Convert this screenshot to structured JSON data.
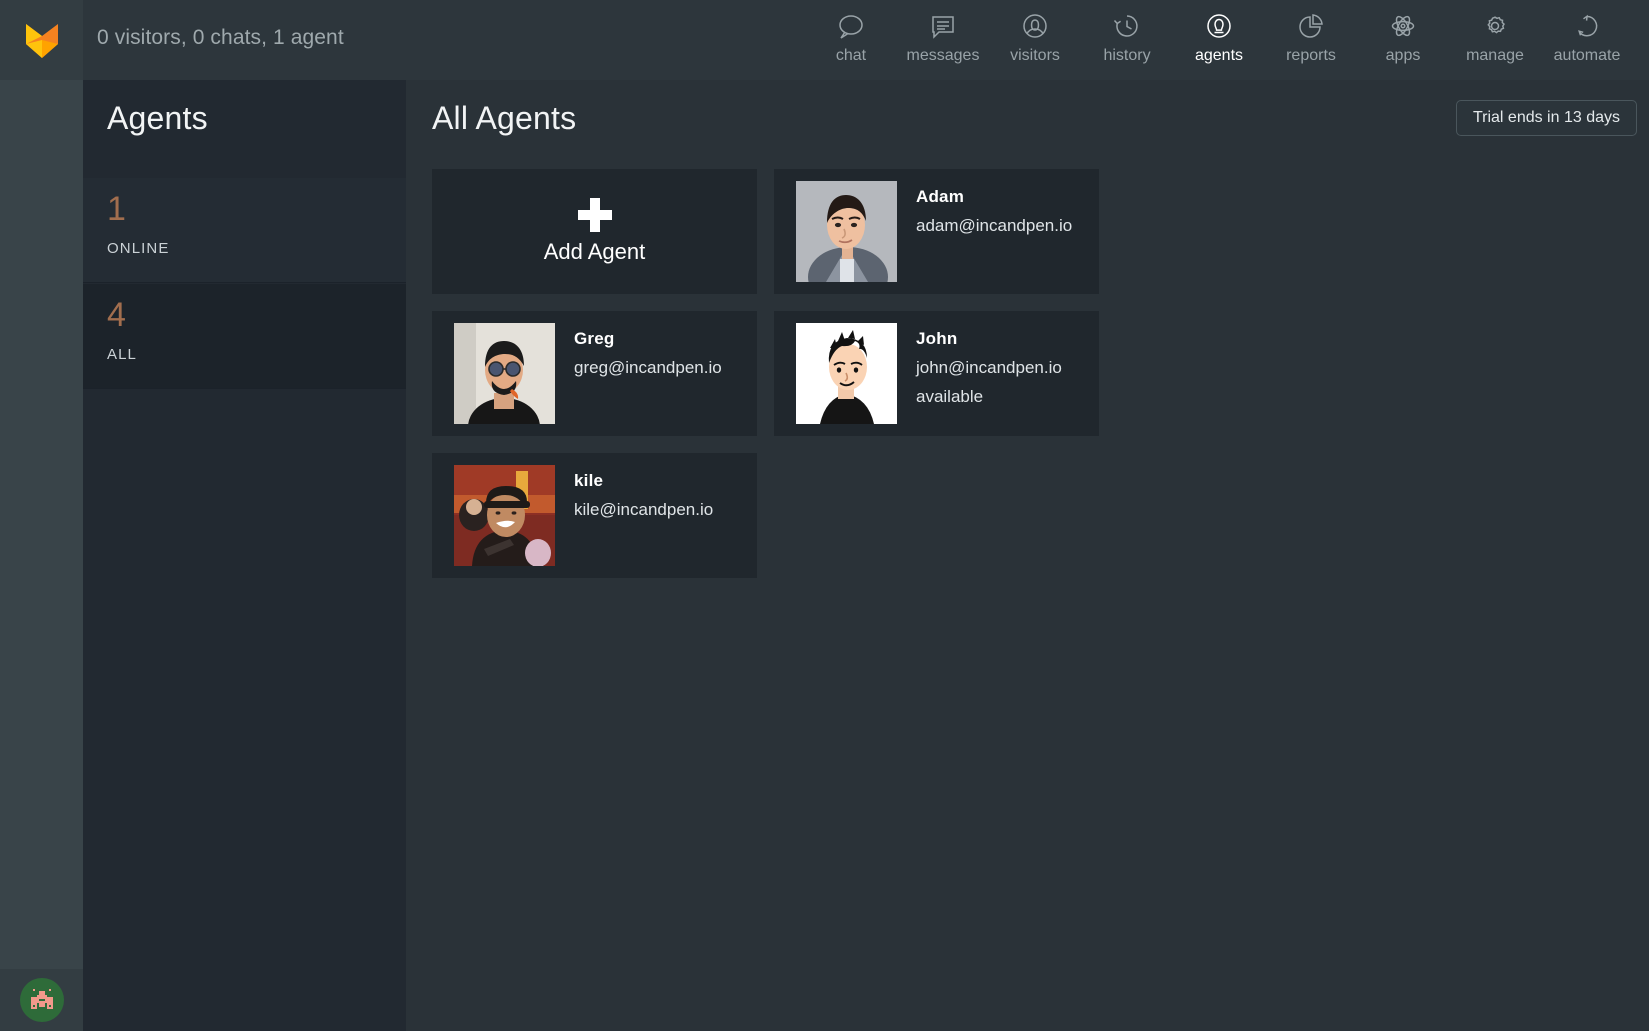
{
  "brand": {
    "logo_icon": "fox-logo-icon",
    "accent": "#f58220"
  },
  "topbar": {
    "status": "0 visitors, 0 chats, 1 agent",
    "nav": [
      {
        "id": "chat",
        "label": "chat",
        "icon": "speech-bubble-icon",
        "active": false
      },
      {
        "id": "messages",
        "label": "messages",
        "icon": "message-lines-icon",
        "active": false
      },
      {
        "id": "visitors",
        "label": "visitors",
        "icon": "person-circle-icon",
        "active": false
      },
      {
        "id": "history",
        "label": "history",
        "icon": "clock-rewind-icon",
        "active": false
      },
      {
        "id": "agents",
        "label": "agents",
        "icon": "agent-circle-icon",
        "active": true
      },
      {
        "id": "reports",
        "label": "reports",
        "icon": "pie-chart-icon",
        "active": false
      },
      {
        "id": "apps",
        "label": "apps",
        "icon": "atom-icon",
        "active": false
      },
      {
        "id": "manage",
        "label": "manage",
        "icon": "gear-icon",
        "active": false
      },
      {
        "id": "automate",
        "label": "automate",
        "icon": "refresh-cycle-icon",
        "active": false
      }
    ]
  },
  "sidebar": {
    "title": "Agents",
    "filters": [
      {
        "count": "1",
        "label": "ONLINE",
        "selected": false
      },
      {
        "count": "4",
        "label": "ALL",
        "selected": true
      }
    ],
    "count_color": "#a26e4e"
  },
  "main": {
    "title": "All Agents",
    "trial_badge": "Trial ends in 13 days",
    "add_agent_label": "Add Agent",
    "agents": [
      {
        "name": "Adam",
        "email": "adam@incandpen.io",
        "status": "",
        "avatar": "photo-adam"
      },
      {
        "name": "Greg",
        "email": "greg@incandpen.io",
        "status": "",
        "avatar": "photo-greg"
      },
      {
        "name": "John",
        "email": "john@incandpen.io",
        "status": "available",
        "avatar": "photo-john"
      },
      {
        "name": "kile",
        "email": "kile@incandpen.io",
        "status": "",
        "avatar": "photo-kile"
      }
    ]
  }
}
